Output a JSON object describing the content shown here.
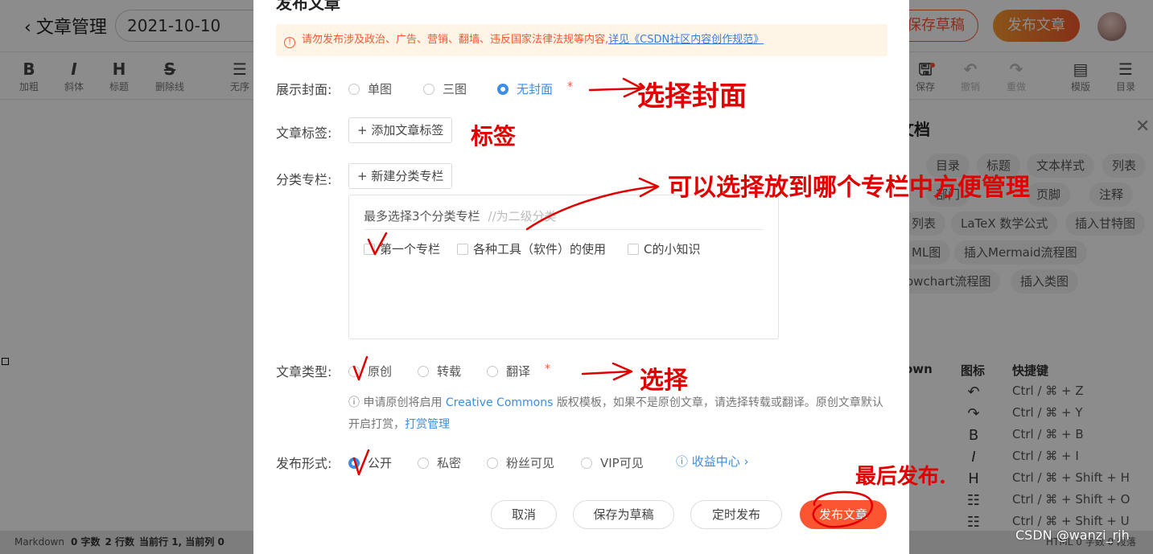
{
  "header": {
    "back_label": "文章管理",
    "title_value": "2021-10-10",
    "save_draft": "保存草稿",
    "publish": "发布文章"
  },
  "toolbar": {
    "left": [
      {
        "icon": "B",
        "label": "加粗"
      },
      {
        "icon": "I",
        "label": "斜体"
      },
      {
        "icon": "H",
        "label": "标题"
      },
      {
        "icon": "S",
        "label": "删除线"
      },
      {
        "icon": "☰",
        "label": "无序"
      }
    ],
    "right": [
      {
        "icon": "🖫",
        "label": "保存"
      },
      {
        "icon": "↶",
        "label": "撤销"
      },
      {
        "icon": "↷",
        "label": "重做"
      },
      {
        "icon": "▤",
        "label": "模版"
      },
      {
        "icon": "☰",
        "label": "目录"
      }
    ]
  },
  "right_panel": {
    "title": "文档",
    "chips": [
      "目录",
      "标题",
      "文本样式",
      "列表",
      "部门",
      "页脚",
      "注释",
      "列表",
      "LaTeX 数学公式",
      "插入甘特图",
      "ML图",
      "插入Mermaid流程图",
      "owchart流程图",
      "插入类图"
    ],
    "shortcut_head": {
      "c1": "own",
      "c2": "图标",
      "c3": "快捷键"
    },
    "shortcuts": [
      {
        "icon": "↶",
        "key": "Ctrl / ⌘ + Z"
      },
      {
        "icon": "↷",
        "key": "Ctrl / ⌘ + Y"
      },
      {
        "icon": "B",
        "key": "Ctrl / ⌘ + B"
      },
      {
        "icon": "I",
        "key": "Ctrl / ⌘ + I"
      },
      {
        "icon": "H",
        "key": "Ctrl / ⌘ + Shift + H"
      },
      {
        "icon": "☷",
        "key": "Ctrl / ⌘ + Shift + O"
      },
      {
        "icon": "☷",
        "key": "Ctrl / ⌘ + Shift + U"
      }
    ]
  },
  "status_bar": {
    "mode": "Markdown",
    "chars": "0 字数",
    "lines": "2 行数",
    "cursor": "当前行 1, 当前列 0",
    "right": "HTML 0 字数 0 段落"
  },
  "modal": {
    "title": "发布文章",
    "notice_text": "请勿发布涉及政治、广告、营销、翻墙、违反国家法律法规等内容,",
    "notice_link": "详见《CSDN社区内容创作规范》",
    "cover": {
      "label": "展示封面:",
      "options": [
        "单图",
        "三图",
        "无封面"
      ],
      "selected": 2
    },
    "tags": {
      "label": "文章标签:",
      "button": "+ 添加文章标签"
    },
    "column": {
      "label": "分类专栏:",
      "button": "+ 新建分类专栏",
      "hint": "最多选择3个分类专栏",
      "hint_sub": "//为二级分类",
      "options": [
        "第一个专栏",
        "各种工具（软件）的使用",
        "C的小知识"
      ]
    },
    "type": {
      "label": "文章类型:",
      "options": [
        "原创",
        "转载",
        "翻译"
      ],
      "note_pre": "ⓘ 申请原创将启用",
      "note_cc": "Creative Commons",
      "note_post": "版权模板，如果不是原创文章，请选择转载或翻译。原创文章默认开启打赏，",
      "note_link": "打赏管理"
    },
    "visibility": {
      "label": "发布形式:",
      "options": [
        "公开",
        "私密",
        "粉丝可见",
        "VIP可见"
      ],
      "selected": 0,
      "income": "ⓘ 收益中心 ›"
    },
    "footer": {
      "cancel": "取消",
      "save_draft": "保存为草稿",
      "schedule": "定时发布",
      "publish": "发布文章"
    }
  },
  "annotations": {
    "cover": "选择封面",
    "tag": "标签",
    "column": "可以选择放到哪个专栏中方便管理",
    "type": "选择",
    "publish": "最后发布."
  },
  "watermark": "CSDN @wanzi_rjh",
  "colors": {
    "accent": "#fc5531",
    "link": "#3a8ee6",
    "annotation": "#e00000"
  }
}
